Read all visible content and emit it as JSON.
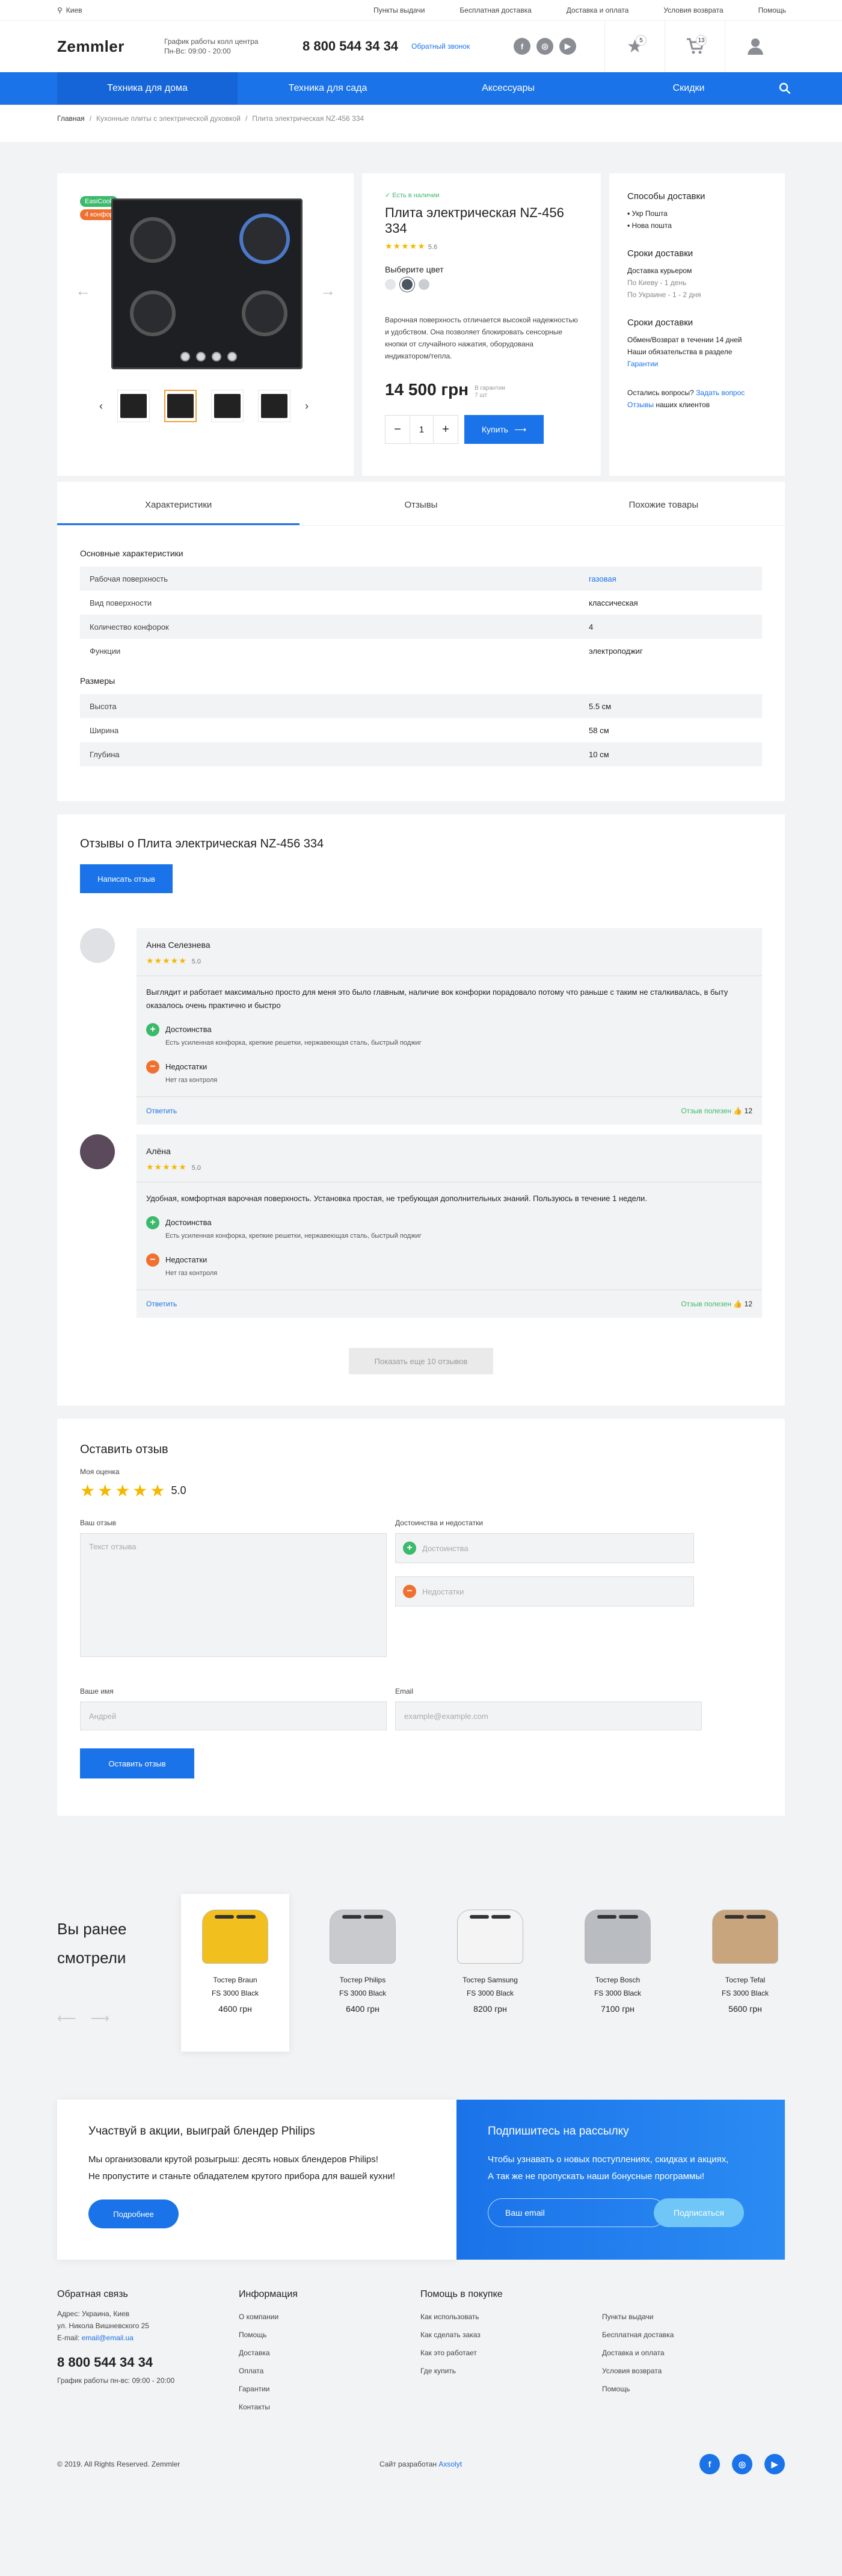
{
  "topbar": {
    "city": "Киев",
    "links": [
      "Пункты выдачи",
      "Бесплатная доставка",
      "Доставка и оплата",
      "Условия возврата",
      "Помощь"
    ]
  },
  "header": {
    "logo": "Zemmler",
    "schedule_title": "График работы колл центра",
    "schedule_hours": "Пн-Вс: 09:00 - 20:00",
    "phone": "8 800 544 34 34",
    "callback": "Обратный звонок",
    "fav_count": "5",
    "cart_count": "13"
  },
  "nav": [
    "Техника для дома",
    "Техника для сада",
    "Аксессуары",
    "Скидки"
  ],
  "breadcrumb": [
    "Главная",
    "Кухонные плиты с электрической духовкой",
    "Плита электрическая NZ-456 334"
  ],
  "product": {
    "labels": [
      "EasiCook",
      "4 конфорки"
    ],
    "stock": "✓ Есть в наличии",
    "title": "Плита электрическая NZ-456 334",
    "rating": "5.6",
    "color_label": "Выберите цвет",
    "colors": [
      "#e4e6e9",
      "#4a5560",
      "#c9ccd1"
    ],
    "description": "Варочная поверхность отличается высокой надежностью и удобством. Она позволяет блокировать сенсорные кнопки от случайного нажатия, оборудована индикатором/тепла.",
    "price": "14 500 грн",
    "price_note1": "В гарантии",
    "price_note2": "7 шт",
    "qty": "1",
    "buy": "Купить"
  },
  "delivery": {
    "methods_title": "Способы доставки",
    "methods": [
      "Укр Пошта",
      "Нова пошта"
    ],
    "terms_title": "Сроки доставки",
    "courier": "Доставка курьером",
    "kiev": "По Киеву - 1 день",
    "ukraine": "По Украине - 1 - 2 дня",
    "return_title": "Сроки доставки",
    "return1": "Обмен/Возврат в течении 14 дней",
    "return2": "Наши обязательства в разделе",
    "return_link": "Гарантии",
    "question": "Остались вопросы?",
    "ask": "Задать вопрос",
    "reviews_link": "Отзывы",
    "reviews_rest": "наших клиентов"
  },
  "tabs": [
    "Характеристики",
    "Отзывы",
    "Похожие товары"
  ],
  "specs": {
    "main_title": "Основные характеристики",
    "main": [
      [
        "Рабочая поверхность",
        "газовая"
      ],
      [
        "Вид поверхности",
        "классическая"
      ],
      [
        "Количество конфорок",
        "4"
      ],
      [
        "Функции",
        "электроподжиг"
      ]
    ],
    "size_title": "Размеры",
    "sizes": [
      [
        "Высота",
        "5.5 см"
      ],
      [
        "Ширина",
        "58 см"
      ],
      [
        "Глубина",
        "10 см"
      ]
    ]
  },
  "reviews": {
    "title": "Отзывы о Плита электрическая NZ-456 334",
    "write": "Написать отзыв",
    "pros_label": "Достоинства",
    "cons_label": "Недостатки",
    "reply": "Ответить",
    "helpful": "Отзыв полезен",
    "items": [
      {
        "name": "Анна Селезнева",
        "rating": "5.0",
        "text": "Выглядит и работает максимально просто для меня это было главным, наличие вок конфорки порадовало потому что раньше с таким не сталкивалась, в быту оказалось очень практично и быстро",
        "pros": "Есть усиленная конфорка, крепкие решетки, нержавеющая сталь, быстрый поджиг",
        "cons": "Нет газ контроля",
        "count": "12"
      },
      {
        "name": "Алёна",
        "rating": "5.0",
        "text": "Удобная, комфортная варочная поверхность. Установка простая, не требующая дополнительных знаний. Пользуюсь в течение 1 недели.",
        "pros": "Есть усиленная конфорка, крепкие решетки, нержавеющая сталь, быстрый поджиг",
        "cons": "Нет газ контроля",
        "count": "12"
      }
    ],
    "more": "Показать еще 10 отзывов"
  },
  "form": {
    "title": "Оставить отзыв",
    "my_rating": "Моя оценка",
    "rating": "5.0",
    "your_review": "Ваш отзыв",
    "review_ph": "Текст отзыва",
    "pc_title": "Достоинства и недостатки",
    "pros_ph": "Достоинства",
    "cons_ph": "Недостатки",
    "name_label": "Ваше имя",
    "name_ph": "Андрей",
    "email_label": "Email",
    "email_ph": "example@example.com",
    "submit": "Оставить отзыв"
  },
  "recent": {
    "title": "Вы ранее смотрели",
    "items": [
      {
        "name": "Тостер Braun",
        "model": "FS 3000 Black",
        "price": "4600 грн",
        "color": "#f2c01e"
      },
      {
        "name": "Тостер Philips",
        "model": "FS 3000 Black",
        "price": "6400 грн",
        "color": "#c8cacd"
      },
      {
        "name": "Тостер Samsung",
        "model": "FS 3000 Black",
        "price": "8200 грн",
        "color": "#f4f4f4"
      },
      {
        "name": "Тостер Bosch",
        "model": "FS 3000 Black",
        "price": "7100 грн",
        "color": "#b9bcc0"
      },
      {
        "name": "Тостер Tefal",
        "model": "FS 3000 Black",
        "price": "5600 грн",
        "color": "#c9a57e"
      }
    ]
  },
  "promo": {
    "title": "Участвуй в акции, выиграй блендер Philips",
    "text1": "Мы организовали крутой розыгрыш: десять новых блендеров Philips!",
    "text2": "Не пропустите и станьте обладателем крутого прибора для вашей кухни!",
    "btn": "Подробнее",
    "sub_title": "Подпишитесь на рассылку",
    "sub_text1": "Чтобы узнавать о новых поступлениях, скидках и акциях,",
    "sub_text2": "А так же не пропускать наши бонусные программы!",
    "sub_ph": "Ваш email",
    "sub_btn": "Подписаться"
  },
  "footer": {
    "feedback": "Обратная связь",
    "addr1": "Адрес: Украина, Киев",
    "addr2": "ул. Никола Вишневского 25",
    "email_label": "E-mail:",
    "email": "email@email.ua",
    "phone": "8 800 544 34 34",
    "hours": "График работы пн-вс: 09:00 - 20:00",
    "info_title": "Информация",
    "info": [
      "О компании",
      "Помощь",
      "Доставка",
      "Оплата",
      "Гарантии",
      "Контакты"
    ],
    "help_title": "Помощь в покупке",
    "help": [
      "Как использовать",
      "Как сделать заказ",
      "Как это работает",
      "Где купить"
    ],
    "extra": [
      "Пункты выдачи",
      "Бесплатная доставка",
      "Доставка и оплата",
      "Условия возврата",
      "Помощь"
    ],
    "copyright": "© 2019. All Rights Reserved. Zemmler",
    "dev": "Сайт разработан",
    "dev_link": "Axsolyt"
  }
}
